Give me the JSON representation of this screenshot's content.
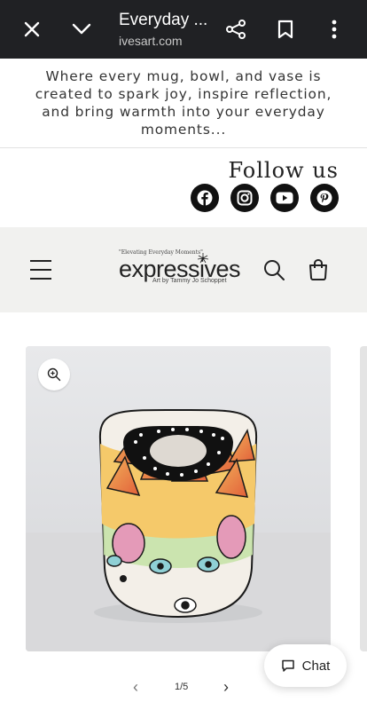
{
  "browser": {
    "title": "Everyday ...",
    "url": "ivesart.com",
    "close_icon": "close-icon",
    "chevron_icon": "chevron-down-icon",
    "share_icon": "share-icon",
    "bookmark_icon": "bookmark-icon",
    "menu_icon": "more-vertical-icon"
  },
  "tagline": "Where every mug, bowl, and vase is created to spark joy, inspire reflection, and bring warmth into your everyday moments...",
  "follow": {
    "heading": "Follow us",
    "networks": [
      "facebook-icon",
      "instagram-icon",
      "youtube-icon",
      "pinterest-icon"
    ]
  },
  "header": {
    "logo_slogan": "\"Elevating Everyday Moments\"",
    "logo_word": "expressives",
    "logo_byline": "Art by Tammy Jo Schoppet",
    "background": "#f1f1ef"
  },
  "product": {
    "pager": {
      "prev": "‹",
      "current": "1/5",
      "next": "›"
    }
  },
  "chat": {
    "label": "Chat"
  },
  "colors": {
    "topbar": "#202124",
    "social": "#111111"
  }
}
